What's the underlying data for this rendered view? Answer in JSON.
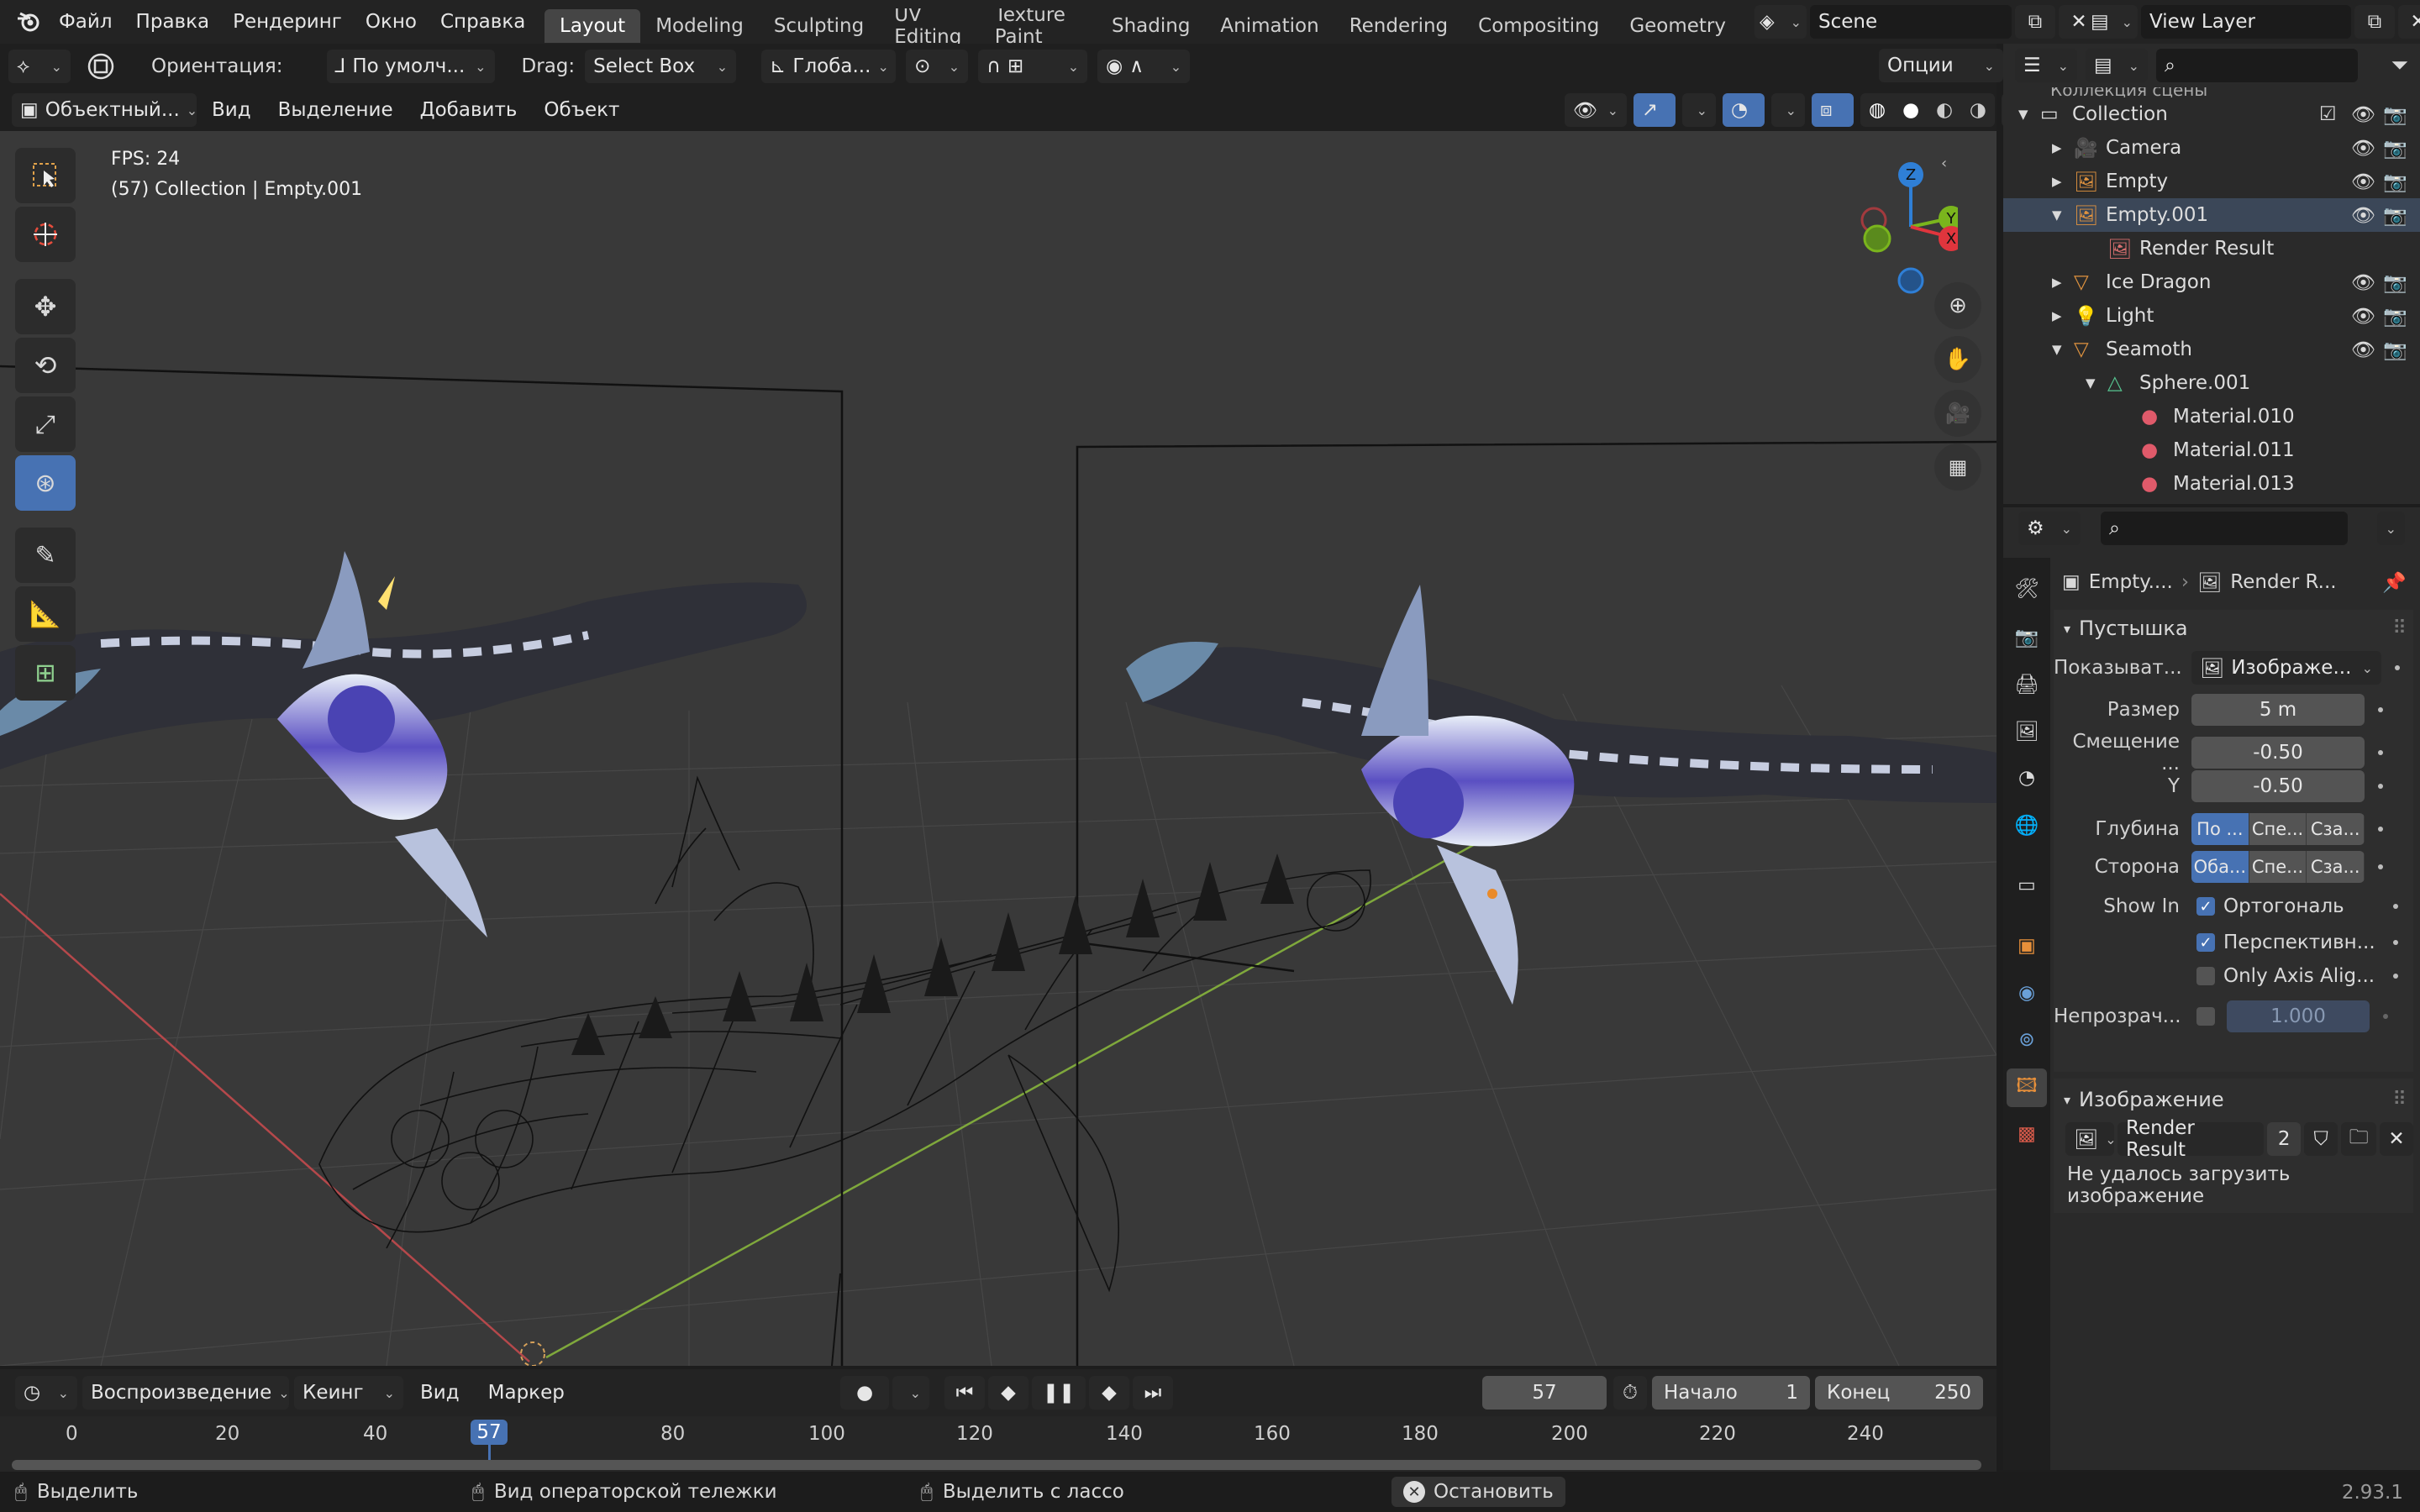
{
  "menubar": {
    "items": [
      "Файл",
      "Правка",
      "Рендеринг",
      "Окно",
      "Справка"
    ],
    "tabs": [
      "Layout",
      "Modeling",
      "Sculpting",
      "UV Editing",
      "Texture Paint",
      "Shading",
      "Animation",
      "Rendering",
      "Compositing",
      "Geometry"
    ],
    "active_tab": "Layout",
    "scene": "Scene",
    "view_layer": "View Layer"
  },
  "tool_header": {
    "orientation_label": "Ориентация:",
    "orientation_value": "По умолч...",
    "drag_label": "Drag:",
    "drag_value": "Select Box",
    "transform_value": "Глоба...",
    "options": "Опции"
  },
  "viewport_header": {
    "mode": "Объектный...",
    "menu": [
      "Вид",
      "Выделение",
      "Добавить",
      "Объект"
    ]
  },
  "viewport": {
    "fps": "FPS: 24",
    "context": "(57) Collection | Empty.001",
    "gizmo_axes": {
      "z": "Z",
      "y": "Y",
      "x": "X"
    }
  },
  "outliner": {
    "root": "Коллекция сцены",
    "rows": [
      {
        "label": "Collection",
        "indent": 0,
        "expanded": true,
        "type": "collection",
        "checkbox": true,
        "eye": true,
        "cam": true
      },
      {
        "label": "Camera",
        "indent": 1,
        "expanded": false,
        "type": "camera",
        "eye": true,
        "cam": true
      },
      {
        "label": "Empty",
        "indent": 1,
        "expanded": false,
        "type": "empty",
        "eye": true,
        "cam": true
      },
      {
        "label": "Empty.001",
        "indent": 1,
        "expanded": true,
        "type": "empty",
        "eye": true,
        "cam": true,
        "selected": true
      },
      {
        "label": "Render Result",
        "indent": 2,
        "type": "image"
      },
      {
        "label": "Ice Dragon",
        "indent": 1,
        "expanded": false,
        "type": "mesh",
        "eye": true,
        "cam": true
      },
      {
        "label": "Light",
        "indent": 1,
        "expanded": false,
        "type": "light",
        "eye": true,
        "cam": true
      },
      {
        "label": "Seamoth",
        "indent": 1,
        "expanded": true,
        "type": "mesh",
        "eye": true,
        "cam": true
      },
      {
        "label": "Sphere.001",
        "indent": 2,
        "expanded": true,
        "type": "meshdata"
      },
      {
        "label": "Material.010",
        "indent": 3,
        "type": "material"
      },
      {
        "label": "Material.011",
        "indent": 3,
        "type": "material"
      },
      {
        "label": "Material.013",
        "indent": 3,
        "type": "material"
      }
    ]
  },
  "properties": {
    "breadcrumb": {
      "object": "Empty....",
      "data": "Render R..."
    },
    "panel_empty": "Пустышка",
    "display_as_label": "Показыват...",
    "display_as_value": "Изображе...",
    "size_label": "Размер",
    "size_value": "5 m",
    "offset_label": "Смещение ...",
    "offset_x": "-0.50",
    "offset_y_label": "Y",
    "offset_y": "-0.50",
    "depth_label": "Глубина",
    "depth_options": [
      "По ...",
      "Спе...",
      "Сза..."
    ],
    "side_label": "Сторона",
    "side_options": [
      "Оба...",
      "Спе...",
      "Сза..."
    ],
    "show_in_label": "Show In",
    "show_in": [
      {
        "label": "Ортогональ",
        "checked": true
      },
      {
        "label": "Перспективн...",
        "checked": true
      },
      {
        "label": "Only Axis Alig...",
        "checked": false
      }
    ],
    "opacity_label": "Непрозрач...",
    "opacity_value": "1.000",
    "panel_image": "Изображение",
    "image_name": "Render Result",
    "image_users": "2",
    "error": "Не удалось загрузить изображение"
  },
  "timeline": {
    "menu": [
      "Воспроизведение",
      "Кеинг",
      "Вид",
      "Маркер"
    ],
    "current_frame": "57",
    "start_label": "Начало",
    "start_value": "1",
    "end_label": "Конец",
    "end_value": "250",
    "ticks": [
      "0",
      "20",
      "40",
      "80",
      "100",
      "120",
      "140",
      "160",
      "180",
      "200",
      "220",
      "240"
    ],
    "playhead_label": "57"
  },
  "statusbar": {
    "select": "Выделить",
    "dolly": "Вид операторской тележки",
    "lasso": "Выделить с лассо",
    "stop": "Остановить",
    "version": "2.93.1"
  },
  "colors": {
    "accent": "#4772b3",
    "x_axis": "#e0353d",
    "y_axis": "#7ab51d",
    "z_axis": "#2f7fd6"
  }
}
